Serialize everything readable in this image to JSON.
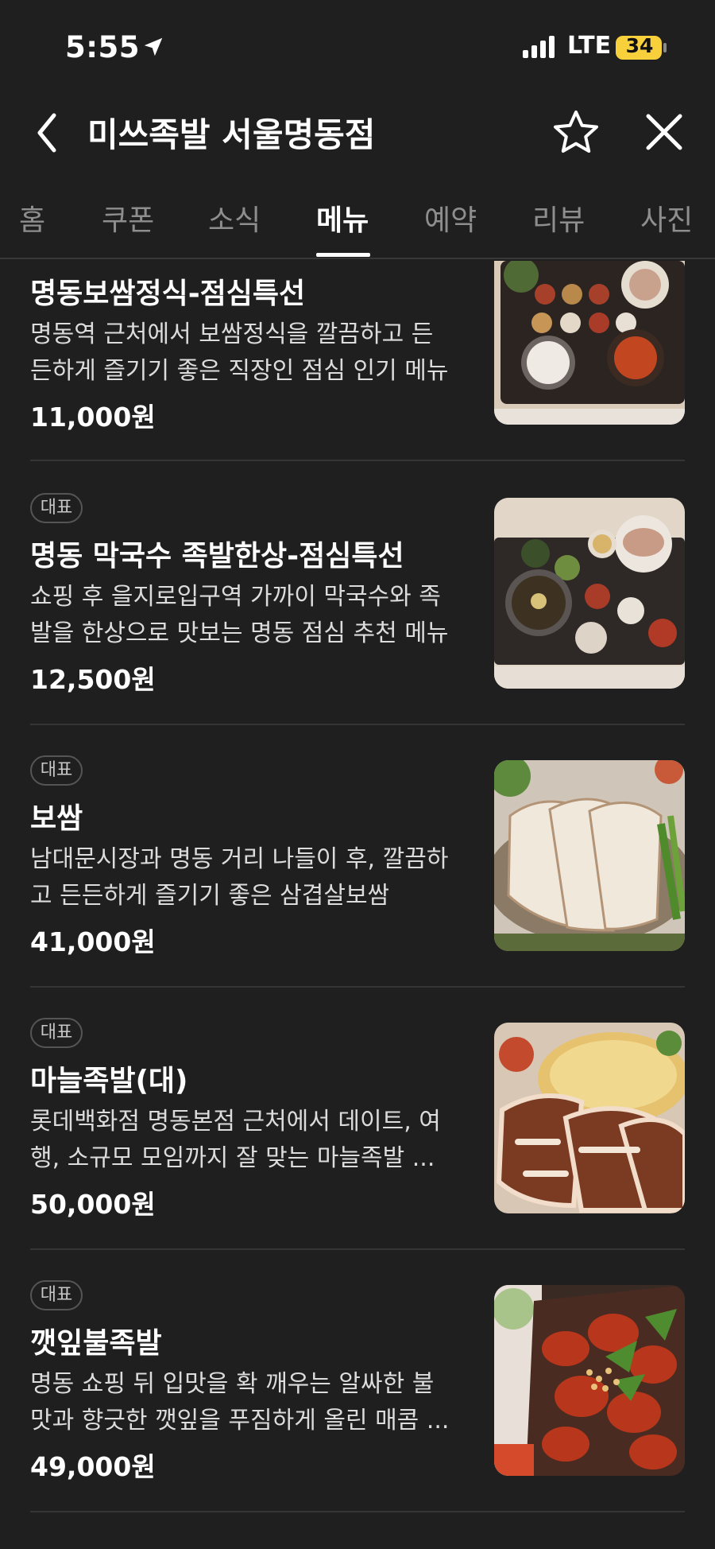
{
  "status_bar": {
    "time": "5:55",
    "network": "LTE",
    "battery": "34"
  },
  "header": {
    "title": "미쓰족발 서울명동점"
  },
  "tabs": [
    {
      "label": "홈"
    },
    {
      "label": "쿠폰"
    },
    {
      "label": "소식"
    },
    {
      "label": "메뉴"
    },
    {
      "label": "예약"
    },
    {
      "label": "리뷰"
    },
    {
      "label": "사진"
    }
  ],
  "active_tab": "메뉴",
  "menu_items": [
    {
      "badge": "",
      "name": "명동보쌈정식-점심특선",
      "desc_line1": "명동역 근처에서 보쌈정식을 깔끔하고 든",
      "desc_line2": "든하게 즐기기 좋은 직장인 점심 인기 메뉴",
      "price": "11,000원"
    },
    {
      "badge": "대표",
      "name": "명동 막국수 족발한상-점심특선",
      "desc_line1": "쇼핑 후 을지로입구역 가까이 막국수와 족",
      "desc_line2": "발을 한상으로 맛보는 명동 점심 추천 메뉴",
      "price": "12,500원"
    },
    {
      "badge": "대표",
      "name": "보쌈",
      "desc_line1": "남대문시장과 명동 거리 나들이 후, 깔끔하",
      "desc_line2": "고 든든하게 즐기기 좋은 삼겹살보쌈",
      "price": "41,000원"
    },
    {
      "badge": "대표",
      "name": "마늘족발(대)",
      "desc_line1": "롯데백화점 명동본점 근처에서 데이트, 여",
      "desc_line2": "행, 소규모 모임까지 잘 맞는 마늘족발 ...",
      "price": "50,000원"
    },
    {
      "badge": "대표",
      "name": "깻잎불족발",
      "desc_line1": "명동 쇼핑 뒤 입맛을 확 깨우는 알싸한 불",
      "desc_line2": "맛과 향긋한 깻잎을 푸짐하게 올린 매콤 ...",
      "price": "49,000원"
    }
  ]
}
